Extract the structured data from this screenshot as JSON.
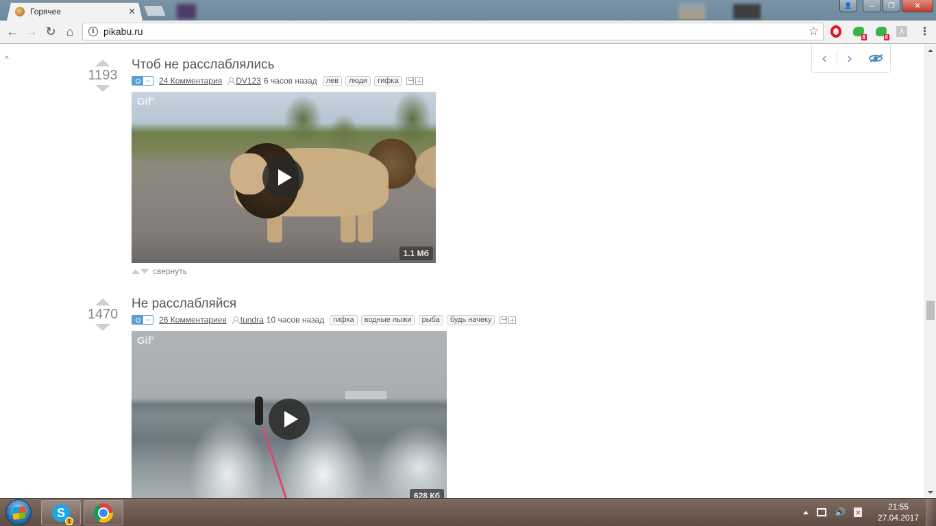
{
  "browser": {
    "tab": {
      "title": "Горячее",
      "close_glyph": "✕",
      "favicon": "pikabu-favicon"
    },
    "url": "pikabu.ru",
    "nav": {
      "back": "←",
      "forward": "→",
      "reload": "↻",
      "home": "⌂",
      "star": "☆",
      "info": "i",
      "menu": "⋮"
    },
    "extensions": [
      {
        "name": "opera-icon"
      },
      {
        "name": "avast-icon",
        "badge": "8"
      },
      {
        "name": "avast-icon",
        "badge": "8"
      },
      {
        "name": "pdf-icon",
        "glyph": "⅄"
      }
    ],
    "window_buttons": {
      "user": "👤",
      "minimize": "–",
      "maximize": "❐",
      "close": "✕"
    }
  },
  "page": {
    "scroll_top_glyph": "^",
    "post_nav": {
      "prev": "‹",
      "next": "›",
      "hide": "hide-icon"
    },
    "posts": [
      {
        "rating": "1193",
        "title": "Чтоб не расслаблялись",
        "mode_dash": "–",
        "comments": "24 Комментария",
        "author": "DV123",
        "time": "6 часов назад",
        "tags": [
          "лев",
          "люди",
          "гифка"
        ],
        "gif": {
          "label": "Gif",
          "label_sup": "x",
          "size": "1.1 Мб"
        },
        "collapse": "свернуть"
      },
      {
        "rating": "1470",
        "title": "Не расслабляйся",
        "mode_dash": "–",
        "comments": "26 Комментариев",
        "author": "tundra",
        "time": "10 часов назад",
        "tags": [
          "гифка",
          "водные лыжи",
          "рыба",
          "будь начеку"
        ],
        "gif": {
          "label": "Gif",
          "label_sup": "x",
          "size": "628 Кб"
        }
      }
    ]
  },
  "taskbar": {
    "apps": [
      {
        "name": "skype",
        "glyph": "S",
        "badge": "1"
      },
      {
        "name": "chrome"
      }
    ],
    "tray": {
      "volume": "🔊"
    },
    "clock": {
      "time": "21:55",
      "date": "27.04.2017"
    }
  },
  "colors": {
    "link_blue": "#5a8ab8",
    "title_gray": "#555555",
    "avast_green": "#38b548",
    "opera_red": "#e0161f"
  }
}
